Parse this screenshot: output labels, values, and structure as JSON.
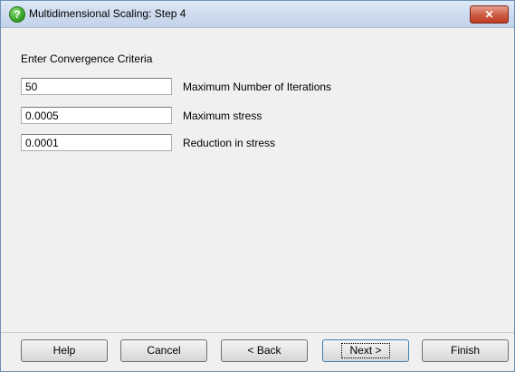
{
  "window": {
    "title": "Multidimensional Scaling: Step 4",
    "close_label": "✕"
  },
  "form": {
    "heading": "Enter Convergence Criteria",
    "fields": [
      {
        "value": "50",
        "label": "Maximum Number of Iterations"
      },
      {
        "value": "0.0005",
        "label": "Maximum stress"
      },
      {
        "value": "0.0001",
        "label": "Reduction in stress"
      }
    ]
  },
  "buttons": {
    "help": "Help",
    "cancel": "Cancel",
    "back": "< Back",
    "next": "Next >",
    "finish": "Finish"
  }
}
